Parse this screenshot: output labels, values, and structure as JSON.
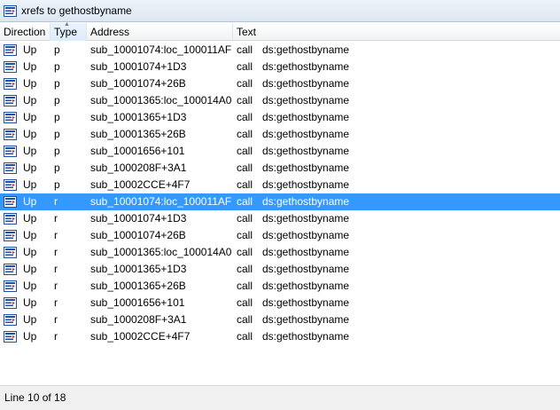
{
  "window": {
    "title": "xrefs to gethostbyname",
    "icon": "xref-icon"
  },
  "columns": {
    "direction": "Direction",
    "type": "Type",
    "address": "Address",
    "text": "Text"
  },
  "rows": [
    {
      "direction": "Up",
      "type": "p",
      "address": "sub_10001074:loc_100011AF",
      "op": "call",
      "operand": "ds:gethostbyname"
    },
    {
      "direction": "Up",
      "type": "p",
      "address": "sub_10001074+1D3",
      "op": "call",
      "operand": "ds:gethostbyname"
    },
    {
      "direction": "Up",
      "type": "p",
      "address": "sub_10001074+26B",
      "op": "call",
      "operand": "ds:gethostbyname"
    },
    {
      "direction": "Up",
      "type": "p",
      "address": "sub_10001365:loc_100014A0",
      "op": "call",
      "operand": "ds:gethostbyname"
    },
    {
      "direction": "Up",
      "type": "p",
      "address": "sub_10001365+1D3",
      "op": "call",
      "operand": "ds:gethostbyname"
    },
    {
      "direction": "Up",
      "type": "p",
      "address": "sub_10001365+26B",
      "op": "call",
      "operand": "ds:gethostbyname"
    },
    {
      "direction": "Up",
      "type": "p",
      "address": "sub_10001656+101",
      "op": "call",
      "operand": "ds:gethostbyname"
    },
    {
      "direction": "Up",
      "type": "p",
      "address": "sub_1000208F+3A1",
      "op": "call",
      "operand": "ds:gethostbyname"
    },
    {
      "direction": "Up",
      "type": "p",
      "address": "sub_10002CCE+4F7",
      "op": "call",
      "operand": "ds:gethostbyname"
    },
    {
      "direction": "Up",
      "type": "r",
      "address": "sub_10001074:loc_100011AF",
      "op": "call",
      "operand": "ds:gethostbyname"
    },
    {
      "direction": "Up",
      "type": "r",
      "address": "sub_10001074+1D3",
      "op": "call",
      "operand": "ds:gethostbyname"
    },
    {
      "direction": "Up",
      "type": "r",
      "address": "sub_10001074+26B",
      "op": "call",
      "operand": "ds:gethostbyname"
    },
    {
      "direction": "Up",
      "type": "r",
      "address": "sub_10001365:loc_100014A0",
      "op": "call",
      "operand": "ds:gethostbyname"
    },
    {
      "direction": "Up",
      "type": "r",
      "address": "sub_10001365+1D3",
      "op": "call",
      "operand": "ds:gethostbyname"
    },
    {
      "direction": "Up",
      "type": "r",
      "address": "sub_10001365+26B",
      "op": "call",
      "operand": "ds:gethostbyname"
    },
    {
      "direction": "Up",
      "type": "r",
      "address": "sub_10001656+101",
      "op": "call",
      "operand": "ds:gethostbyname"
    },
    {
      "direction": "Up",
      "type": "r",
      "address": "sub_1000208F+3A1",
      "op": "call",
      "operand": "ds:gethostbyname"
    },
    {
      "direction": "Up",
      "type": "r",
      "address": "sub_10002CCE+4F7",
      "op": "call",
      "operand": "ds:gethostbyname"
    }
  ],
  "selected_row": 10,
  "status": "Line 10 of 18",
  "colors": {
    "selection": "#3399ff",
    "icon_blue": "#1f4fa6",
    "icon_red": "#d02020"
  }
}
